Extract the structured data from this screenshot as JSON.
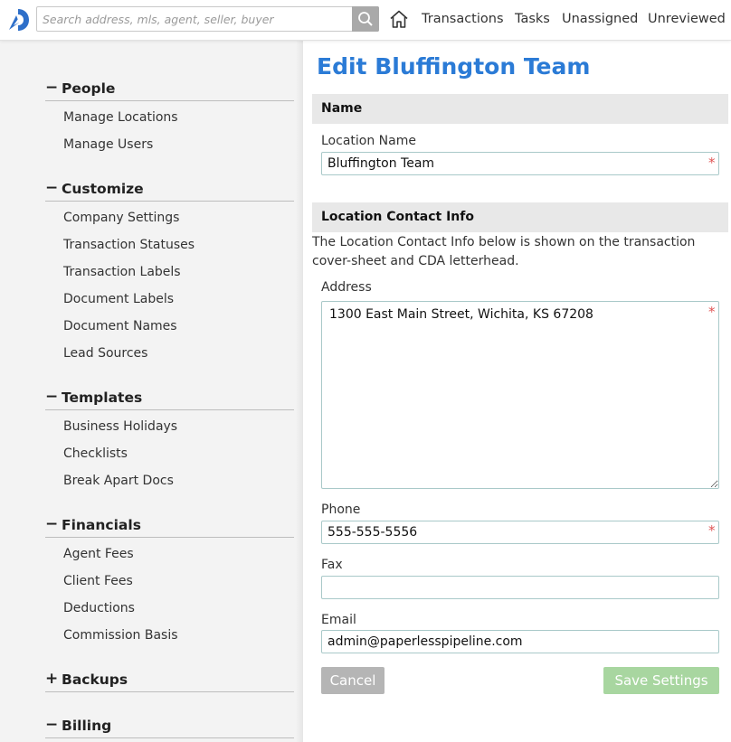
{
  "topbar": {
    "search_placeholder": "Search address, mls, agent, seller, buyer",
    "nav": [
      "Transactions",
      "Tasks",
      "Unassigned",
      "Unreviewed"
    ]
  },
  "sidebar": {
    "sections": [
      {
        "toggle": "−",
        "title": "People",
        "items": [
          "Manage Locations",
          "Manage Users"
        ]
      },
      {
        "toggle": "−",
        "title": "Customize",
        "items": [
          "Company Settings",
          "Transaction Statuses",
          "Transaction Labels",
          "Document Labels",
          "Document Names",
          "Lead Sources"
        ]
      },
      {
        "toggle": "−",
        "title": "Templates",
        "items": [
          "Business Holidays",
          "Checklists",
          "Break Apart Docs"
        ]
      },
      {
        "toggle": "−",
        "title": "Financials",
        "items": [
          "Agent Fees",
          "Client Fees",
          "Deductions",
          "Commission Basis"
        ]
      },
      {
        "toggle": "+",
        "title": "Backups",
        "items": []
      },
      {
        "toggle": "−",
        "title": "Billing",
        "items": []
      }
    ]
  },
  "main": {
    "title": "Edit Bluffington Team",
    "name_section": "Name",
    "location_name_label": "Location Name",
    "location_name_value": "Bluffington Team",
    "contact_section": "Location Contact Info",
    "contact_info_text": "The Location Contact Info below is shown on the transaction cover-sheet and CDA letterhead.",
    "address_label": "Address",
    "address_value": "1300 East Main Street, Wichita, KS 67208",
    "phone_label": "Phone",
    "phone_value": "555-555-5556",
    "fax_label": "Fax",
    "fax_value": "",
    "email_label": "Email",
    "email_value": "admin@paperlesspipeline.com",
    "required_mark": "*",
    "cancel_label": "Cancel",
    "save_label": "Save Settings"
  },
  "colors": {
    "title_blue": "#2b7bd6",
    "logo_blue": "#2e6fc9",
    "save_green": "#a8d6a0",
    "cancel_gray": "#b5b5b5",
    "required_red": "#e05555"
  },
  "icons": [
    "logo-icon",
    "search-icon",
    "home-icon"
  ]
}
